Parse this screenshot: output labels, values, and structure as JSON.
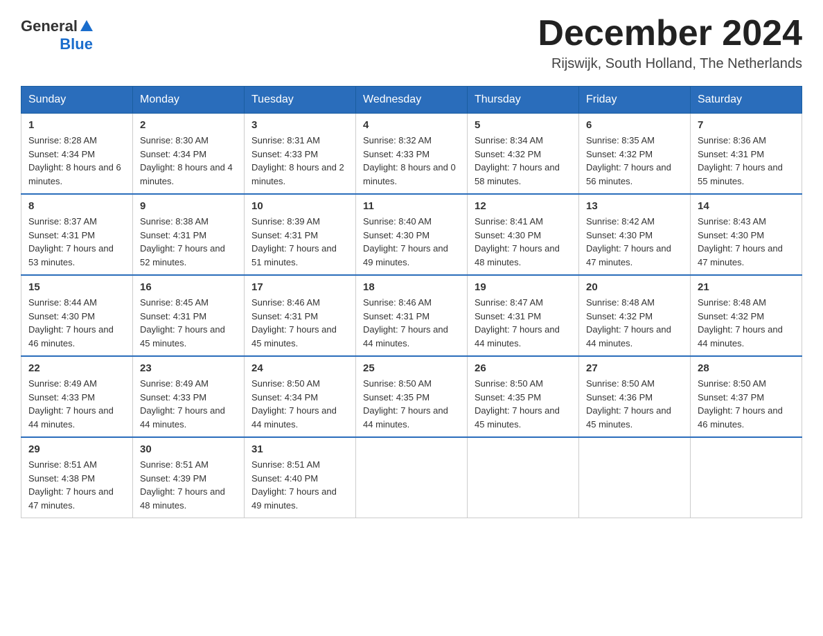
{
  "logo": {
    "general": "General",
    "blue": "Blue"
  },
  "title": "December 2024",
  "subtitle": "Rijswijk, South Holland, The Netherlands",
  "weekdays": [
    "Sunday",
    "Monday",
    "Tuesday",
    "Wednesday",
    "Thursday",
    "Friday",
    "Saturday"
  ],
  "weeks": [
    [
      {
        "day": "1",
        "sunrise": "8:28 AM",
        "sunset": "4:34 PM",
        "daylight": "8 hours and 6 minutes."
      },
      {
        "day": "2",
        "sunrise": "8:30 AM",
        "sunset": "4:34 PM",
        "daylight": "8 hours and 4 minutes."
      },
      {
        "day": "3",
        "sunrise": "8:31 AM",
        "sunset": "4:33 PM",
        "daylight": "8 hours and 2 minutes."
      },
      {
        "day": "4",
        "sunrise": "8:32 AM",
        "sunset": "4:33 PM",
        "daylight": "8 hours and 0 minutes."
      },
      {
        "day": "5",
        "sunrise": "8:34 AM",
        "sunset": "4:32 PM",
        "daylight": "7 hours and 58 minutes."
      },
      {
        "day": "6",
        "sunrise": "8:35 AM",
        "sunset": "4:32 PM",
        "daylight": "7 hours and 56 minutes."
      },
      {
        "day": "7",
        "sunrise": "8:36 AM",
        "sunset": "4:31 PM",
        "daylight": "7 hours and 55 minutes."
      }
    ],
    [
      {
        "day": "8",
        "sunrise": "8:37 AM",
        "sunset": "4:31 PM",
        "daylight": "7 hours and 53 minutes."
      },
      {
        "day": "9",
        "sunrise": "8:38 AM",
        "sunset": "4:31 PM",
        "daylight": "7 hours and 52 minutes."
      },
      {
        "day": "10",
        "sunrise": "8:39 AM",
        "sunset": "4:31 PM",
        "daylight": "7 hours and 51 minutes."
      },
      {
        "day": "11",
        "sunrise": "8:40 AM",
        "sunset": "4:30 PM",
        "daylight": "7 hours and 49 minutes."
      },
      {
        "day": "12",
        "sunrise": "8:41 AM",
        "sunset": "4:30 PM",
        "daylight": "7 hours and 48 minutes."
      },
      {
        "day": "13",
        "sunrise": "8:42 AM",
        "sunset": "4:30 PM",
        "daylight": "7 hours and 47 minutes."
      },
      {
        "day": "14",
        "sunrise": "8:43 AM",
        "sunset": "4:30 PM",
        "daylight": "7 hours and 47 minutes."
      }
    ],
    [
      {
        "day": "15",
        "sunrise": "8:44 AM",
        "sunset": "4:30 PM",
        "daylight": "7 hours and 46 minutes."
      },
      {
        "day": "16",
        "sunrise": "8:45 AM",
        "sunset": "4:31 PM",
        "daylight": "7 hours and 45 minutes."
      },
      {
        "day": "17",
        "sunrise": "8:46 AM",
        "sunset": "4:31 PM",
        "daylight": "7 hours and 45 minutes."
      },
      {
        "day": "18",
        "sunrise": "8:46 AM",
        "sunset": "4:31 PM",
        "daylight": "7 hours and 44 minutes."
      },
      {
        "day": "19",
        "sunrise": "8:47 AM",
        "sunset": "4:31 PM",
        "daylight": "7 hours and 44 minutes."
      },
      {
        "day": "20",
        "sunrise": "8:48 AM",
        "sunset": "4:32 PM",
        "daylight": "7 hours and 44 minutes."
      },
      {
        "day": "21",
        "sunrise": "8:48 AM",
        "sunset": "4:32 PM",
        "daylight": "7 hours and 44 minutes."
      }
    ],
    [
      {
        "day": "22",
        "sunrise": "8:49 AM",
        "sunset": "4:33 PM",
        "daylight": "7 hours and 44 minutes."
      },
      {
        "day": "23",
        "sunrise": "8:49 AM",
        "sunset": "4:33 PM",
        "daylight": "7 hours and 44 minutes."
      },
      {
        "day": "24",
        "sunrise": "8:50 AM",
        "sunset": "4:34 PM",
        "daylight": "7 hours and 44 minutes."
      },
      {
        "day": "25",
        "sunrise": "8:50 AM",
        "sunset": "4:35 PM",
        "daylight": "7 hours and 44 minutes."
      },
      {
        "day": "26",
        "sunrise": "8:50 AM",
        "sunset": "4:35 PM",
        "daylight": "7 hours and 45 minutes."
      },
      {
        "day": "27",
        "sunrise": "8:50 AM",
        "sunset": "4:36 PM",
        "daylight": "7 hours and 45 minutes."
      },
      {
        "day": "28",
        "sunrise": "8:50 AM",
        "sunset": "4:37 PM",
        "daylight": "7 hours and 46 minutes."
      }
    ],
    [
      {
        "day": "29",
        "sunrise": "8:51 AM",
        "sunset": "4:38 PM",
        "daylight": "7 hours and 47 minutes."
      },
      {
        "day": "30",
        "sunrise": "8:51 AM",
        "sunset": "4:39 PM",
        "daylight": "7 hours and 48 minutes."
      },
      {
        "day": "31",
        "sunrise": "8:51 AM",
        "sunset": "4:40 PM",
        "daylight": "7 hours and 49 minutes."
      },
      null,
      null,
      null,
      null
    ]
  ]
}
